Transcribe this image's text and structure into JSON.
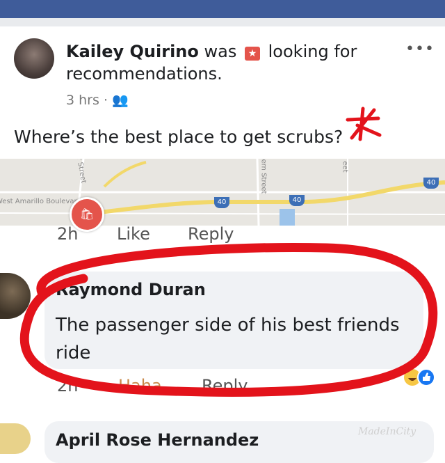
{
  "post": {
    "author": "Kailey Quirino",
    "status_prefix": "was",
    "status_suffix": "looking for recommendations.",
    "time": "3 hrs",
    "text": "Where’s the best place to get scrubs?"
  },
  "map": {
    "streets": [
      "ter Street",
      "tern Street",
      "eet",
      "West Amarillo Boulevard"
    ],
    "shields": [
      "40",
      "40",
      "40"
    ]
  },
  "post_actions": {
    "time": "2h",
    "like": "Like",
    "reply": "Reply"
  },
  "comment": {
    "author": "Raymond Duran",
    "text": "The passenger side of his best friends ride",
    "time": "2h",
    "like": "Haha",
    "reply": "Reply"
  },
  "next_comment": {
    "author": "April Rose Hernandez"
  },
  "watermark": "MadeInCity",
  "colors": {
    "brand": "#3f5c9a",
    "annotation": "#e3131b",
    "reaction_like": "#1877f2",
    "reaction_haha": "#f7c744"
  },
  "icons": {
    "more": "more-horizontal-icon",
    "audience": "friends-icon",
    "badge": "recommendation-icon",
    "pin": "store-pin-icon"
  }
}
